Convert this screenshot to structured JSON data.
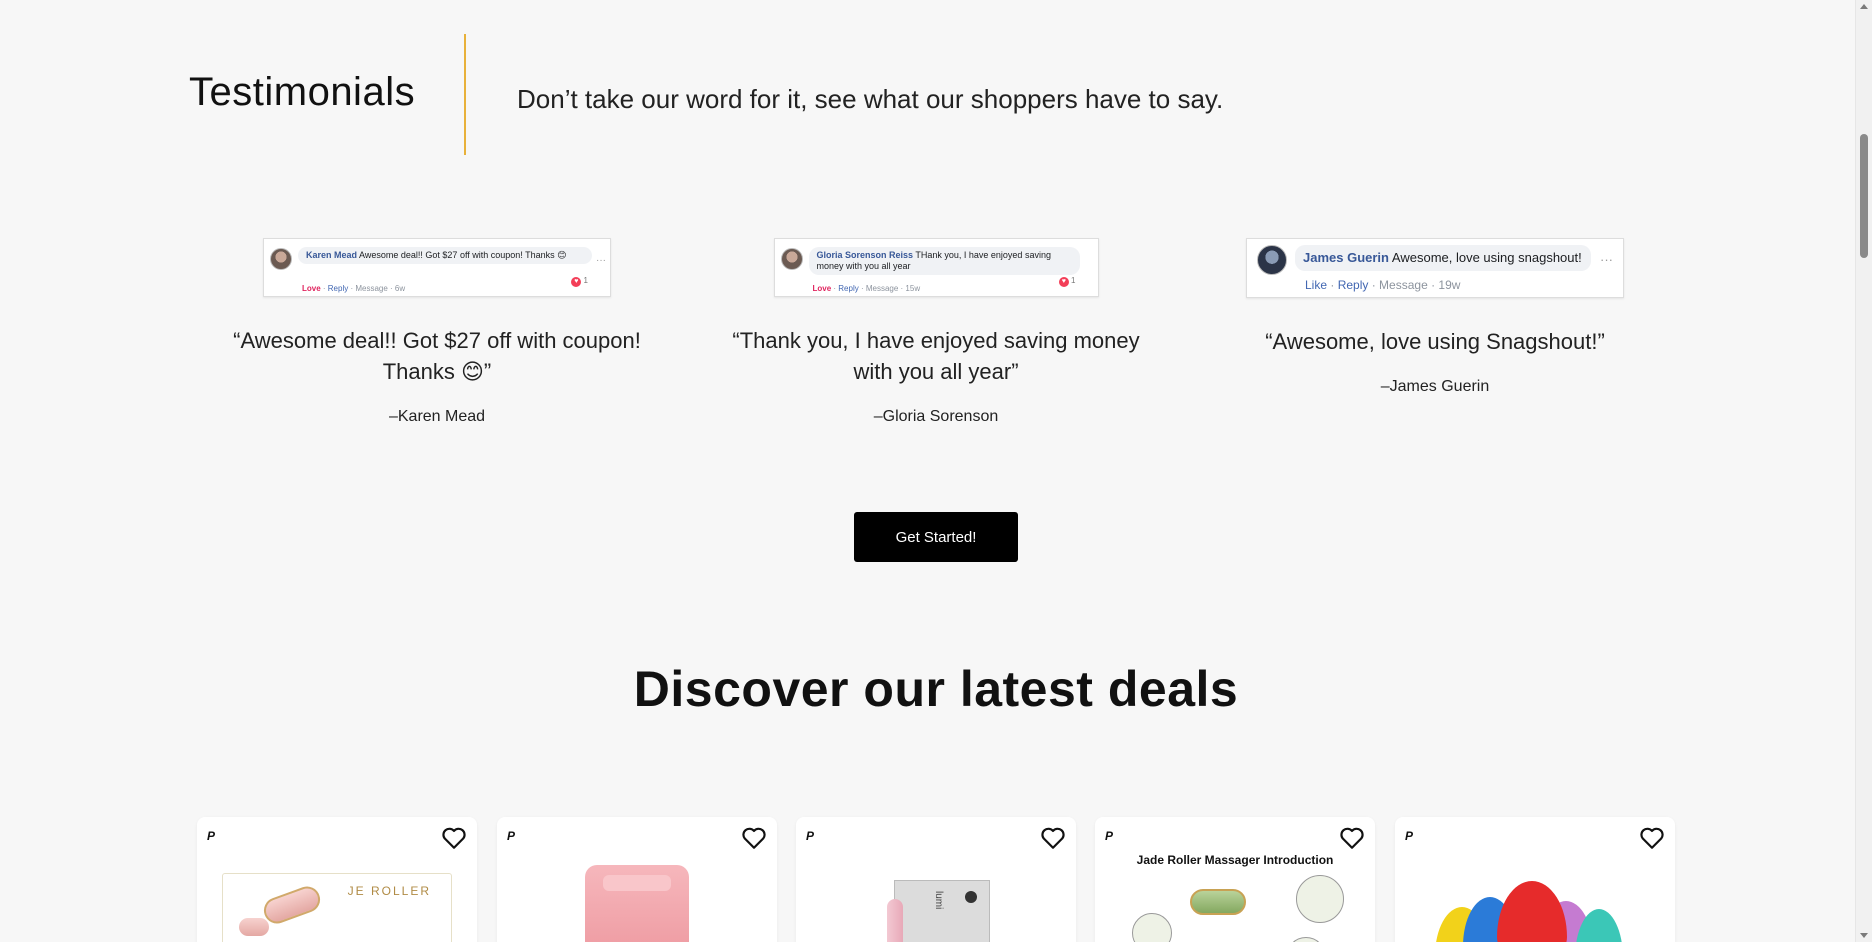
{
  "testimonials": {
    "title": "Testimonials",
    "subtitle": "Don’t take our word for it, see what our shoppers have to say.",
    "items": [
      {
        "fb_name": "Karen Mead",
        "fb_comment": "Awesome deal!! Got $27 off with coupon! Thanks 😊",
        "fb_love": "Love",
        "fb_reply": "Reply",
        "fb_message": "Message",
        "fb_time": "6w",
        "fb_reactions": "1",
        "quote": "“Awesome deal!! Got $27 off with coupon! Thanks 😊”",
        "author": "–Karen Mead"
      },
      {
        "fb_name": "Gloria Sorenson Reiss",
        "fb_comment": "THank you, I have enjoyed saving money with you all year",
        "fb_love": "Love",
        "fb_reply": "Reply",
        "fb_message": "Message",
        "fb_time": "15w",
        "fb_reactions": "1",
        "quote": "“Thank you, I have enjoyed saving money with you all year”",
        "author": "–Gloria Sorenson"
      },
      {
        "fb_name": "James Guerin",
        "fb_comment": "Awesome, love using snagshout!",
        "fb_like": "Like",
        "fb_reply": "Reply",
        "fb_message": "Message",
        "fb_time": "19w",
        "quote": "“Awesome, love using Snagshout!”",
        "author": "–James Guerin"
      }
    ]
  },
  "cta": {
    "label": "Get Started!"
  },
  "deals": {
    "title": "Discover our latest deals",
    "cards": [
      {
        "image": "rose quartz roller box",
        "brand_text": "JE ROLLER",
        "payment_icon": "paypal-icon",
        "favorite_icon": "heart-icon"
      },
      {
        "image": "pink ice roller",
        "payment_icon": "paypal-icon",
        "favorite_icon": "heart-icon"
      },
      {
        "image": "pink beauty tool with box",
        "box_text": "lumi",
        "payment_icon": "paypal-icon",
        "favorite_icon": "heart-icon"
      },
      {
        "image": "jade roller introduction",
        "caption": "Jade Roller Massager Introduction",
        "payment_icon": "paypal-icon",
        "favorite_icon": "heart-icon"
      },
      {
        "image": "colorful makeup sponges",
        "payment_icon": "paypal-icon",
        "favorite_icon": "heart-icon"
      }
    ]
  },
  "colors": {
    "background": "#f7f7f7",
    "divider_accent": "#e8b13a",
    "cta_background": "#000000",
    "cta_text": "#ffffff"
  }
}
